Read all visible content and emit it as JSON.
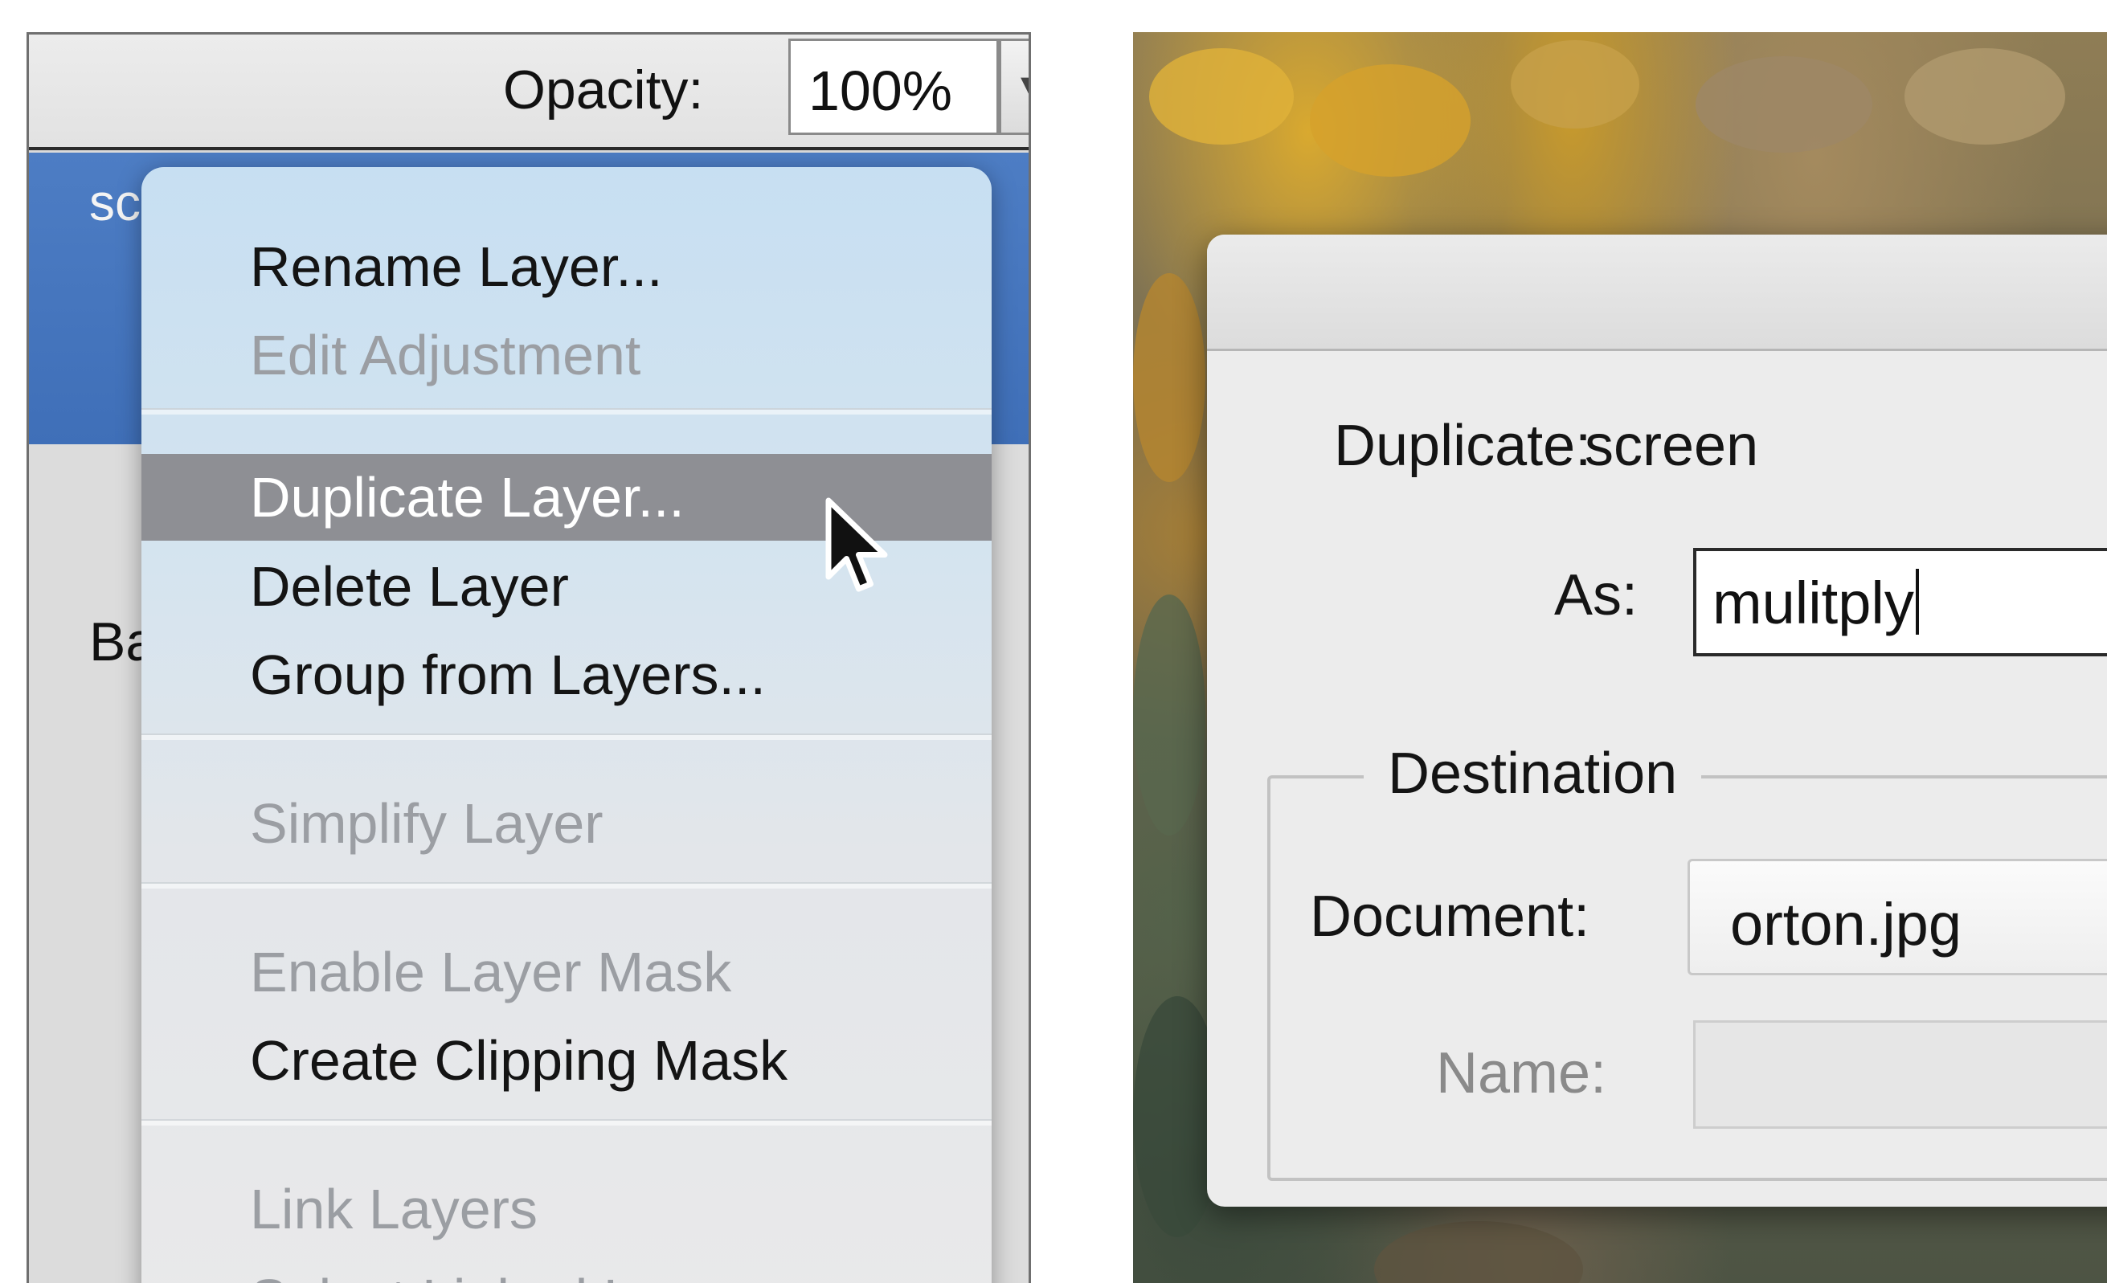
{
  "layers_panel": {
    "opacity_label": "Opacity:",
    "opacity_value": "100%",
    "selected_layer_partial": "sc",
    "background_layer_partial": "Ba"
  },
  "context_menu": {
    "items": [
      {
        "label": "Rename Layer...",
        "enabled": true
      },
      {
        "label": "Edit Adjustment",
        "enabled": false
      },
      {
        "label": "Duplicate Layer...",
        "enabled": true,
        "highlighted": true
      },
      {
        "label": "Delete Layer",
        "enabled": true
      },
      {
        "label": "Group from Layers...",
        "enabled": true
      },
      {
        "label": "Simplify Layer",
        "enabled": false
      },
      {
        "label": "Enable Layer Mask",
        "enabled": false
      },
      {
        "label": "Create Clipping Mask",
        "enabled": true
      },
      {
        "label": "Link Layers",
        "enabled": false
      },
      {
        "label": "Select Linked Layers",
        "enabled": false
      }
    ]
  },
  "duplicate_dialog": {
    "duplicate_label": "Duplicate:",
    "duplicate_value": "screen",
    "as_label": "As:",
    "as_value": "mulitply",
    "destination_label": "Destination",
    "document_label": "Document:",
    "document_value": "orton.jpg",
    "name_label": "Name:",
    "name_value": ""
  },
  "colors": {
    "selection_blue": "#4570b9",
    "menu_highlight": "#8e8f94",
    "disabled_text": "#9b9ea3"
  }
}
